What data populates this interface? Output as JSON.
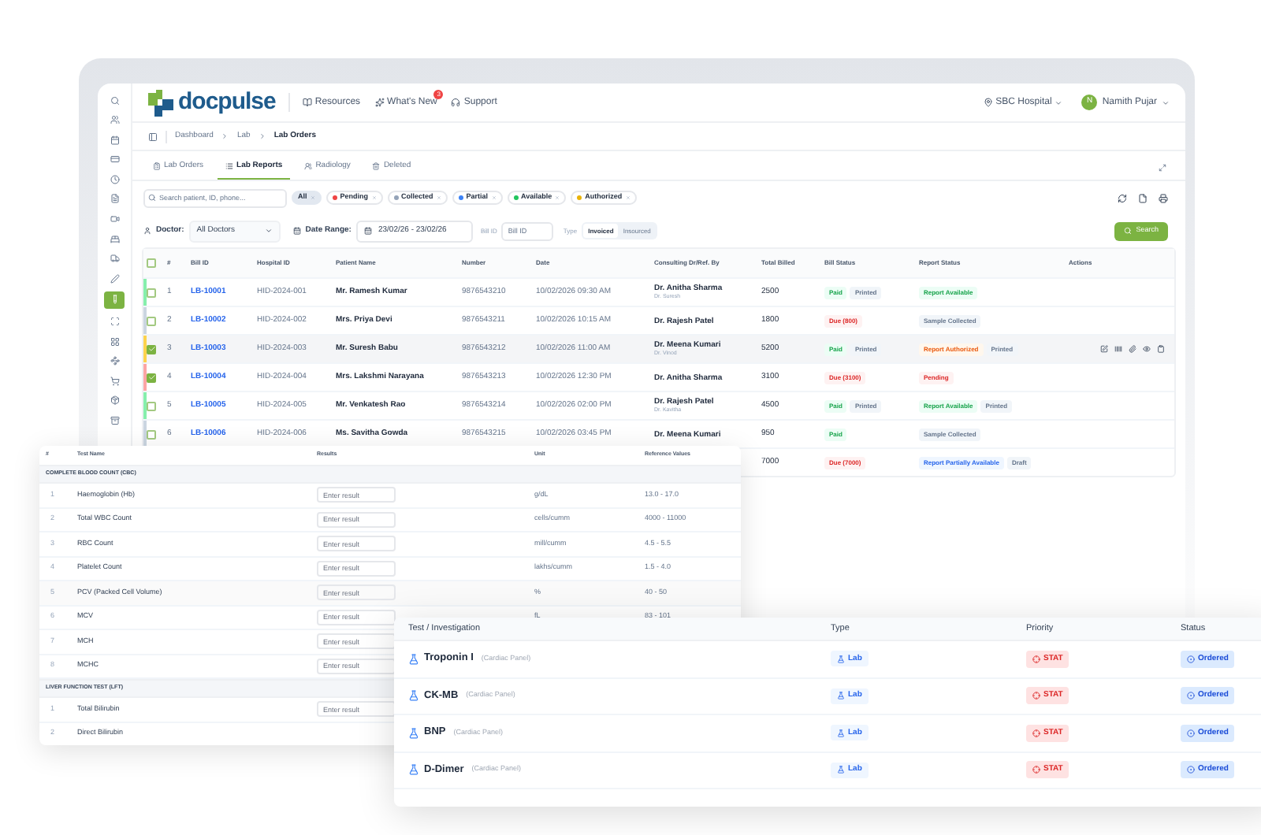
{
  "sidebar": {
    "items": [
      {
        "selected": false
      },
      {
        "selected": false
      },
      {
        "selected": false
      },
      {
        "selected": false
      },
      {
        "selected": false
      },
      {
        "selected": false
      },
      {
        "selected": false
      },
      {
        "selected": false
      },
      {
        "selected": false
      },
      {
        "selected": false
      },
      {
        "selected": true
      },
      {
        "selected": false
      },
      {
        "selected": false
      },
      {
        "selected": false
      },
      {
        "selected": false
      },
      {
        "selected": false
      },
      {
        "selected": false
      }
    ]
  },
  "header": {
    "logo": "docpulse",
    "nav": [
      {
        "label": "Resources"
      },
      {
        "label": "What's New",
        "badge": "3"
      },
      {
        "label": "Support"
      }
    ],
    "hospital": "SBC Hospital",
    "user": {
      "initial": "N",
      "name": "Namith Pujar"
    }
  },
  "breadcrumb": [
    "Dashboard",
    "Lab",
    "Lab Orders"
  ],
  "tabs": [
    {
      "label": "Lab Orders",
      "selected": false
    },
    {
      "label": "Lab Reports",
      "selected": true
    },
    {
      "label": "Radiology",
      "selected": false
    },
    {
      "label": "Deleted",
      "selected": false
    }
  ],
  "filters": {
    "search_placeholder": "Search patient, ID, phone...",
    "chips": [
      {
        "label": "All",
        "selected": true
      },
      {
        "label": "Pending",
        "color": "#ef4444",
        "selected": false
      },
      {
        "label": "Collected",
        "color": "#94a3b8",
        "selected": false
      },
      {
        "label": "Partial",
        "color": "#3b82f6",
        "selected": false
      },
      {
        "label": "Available",
        "color": "#22c55e",
        "selected": false
      },
      {
        "label": "Authorized",
        "color": "#eab308",
        "selected": false
      }
    ],
    "doctor": {
      "label": "Doctor:",
      "value": "All Doctors"
    },
    "date": {
      "label": "Date Range:",
      "value": "23/02/26 - 23/02/26"
    },
    "bill_id": {
      "label": "Bill ID",
      "placeholder": "Bill ID"
    },
    "type": {
      "label": "Type",
      "options": [
        {
          "label": "Invoiced",
          "selected": true
        },
        {
          "label": "Insourced",
          "selected": false
        }
      ]
    },
    "search_button": "Search"
  },
  "table": {
    "all_checked": false,
    "columns": [
      "#",
      "Bill ID",
      "Hospital ID",
      "Patient Name",
      "Number",
      "Date",
      "Consulting Dr/Ref. By",
      "Total Billed",
      "Bill Status",
      "Report Status",
      "Actions"
    ],
    "rows": [
      {
        "checked": false,
        "hovered": false,
        "color": "#86efac",
        "num": "1",
        "bill_id": "LB-10001",
        "hospital_id": "HID-2024-001",
        "patient": "Mr. Ramesh Kumar",
        "number": "9876543210",
        "date": "10/02/2026 09:30 AM",
        "doctor": "Dr. Anitha Sharma",
        "ref": "Dr. Suresh",
        "total": "2500",
        "bill_status": [
          {
            "label": "Paid",
            "kind": "green"
          },
          {
            "label": "Printed",
            "kind": "gray"
          }
        ],
        "report_status": [
          {
            "label": "Report Available",
            "kind": "green"
          }
        ]
      },
      {
        "checked": false,
        "hovered": false,
        "color": "#cbd5e1",
        "num": "2",
        "bill_id": "LB-10002",
        "hospital_id": "HID-2024-002",
        "patient": "Mrs. Priya Devi",
        "number": "9876543211",
        "date": "10/02/2026 10:15 AM",
        "doctor": "Dr. Rajesh Patel",
        "total": "1800",
        "bill_status": [
          {
            "label": "Due (800)",
            "kind": "red"
          }
        ],
        "report_status": [
          {
            "label": "Sample Collected",
            "kind": "gray"
          }
        ]
      },
      {
        "checked": true,
        "hovered": true,
        "color": "#fcd34d",
        "num": "3",
        "bill_id": "LB-10003",
        "hospital_id": "HID-2024-003",
        "patient": "Mr. Suresh Babu",
        "number": "9876543212",
        "date": "10/02/2026 11:00 AM",
        "doctor": "Dr. Meena Kumari",
        "ref": "Dr. Vinod",
        "total": "5200",
        "bill_status": [
          {
            "label": "Paid",
            "kind": "green"
          },
          {
            "label": "Printed",
            "kind": "gray"
          }
        ],
        "report_status": [
          {
            "label": "Report Authorized",
            "kind": "orange"
          },
          {
            "label": "Printed",
            "kind": "gray"
          }
        ]
      },
      {
        "checked": true,
        "hovered": false,
        "color": "#fca5a5",
        "num": "4",
        "bill_id": "LB-10004",
        "hospital_id": "HID-2024-004",
        "patient": "Mrs. Lakshmi Narayana",
        "number": "9876543213",
        "date": "10/02/2026 12:30 PM",
        "doctor": "Dr. Anitha Sharma",
        "total": "3100",
        "bill_status": [
          {
            "label": "Due (3100)",
            "kind": "red"
          }
        ],
        "report_status": [
          {
            "label": "Pending",
            "kind": "red"
          }
        ]
      },
      {
        "checked": false,
        "hovered": false,
        "color": "#86efac",
        "num": "5",
        "bill_id": "LB-10005",
        "hospital_id": "HID-2024-005",
        "patient": "Mr. Venkatesh Rao",
        "number": "9876543214",
        "date": "10/02/2026 02:00 PM",
        "doctor": "Dr. Rajesh Patel",
        "ref": "Dr. Kavitha",
        "total": "4500",
        "bill_status": [
          {
            "label": "Paid",
            "kind": "green"
          },
          {
            "label": "Printed",
            "kind": "gray"
          }
        ],
        "report_status": [
          {
            "label": "Report Available",
            "kind": "green"
          },
          {
            "label": "Printed",
            "kind": "gray"
          }
        ]
      },
      {
        "checked": false,
        "hovered": false,
        "color": "#cbd5e1",
        "num": "6",
        "bill_id": "LB-10006",
        "hospital_id": "HID-2024-006",
        "patient": "Ms. Savitha Gowda",
        "number": "9876543215",
        "date": "10/02/2026 03:45 PM",
        "doctor": "Dr. Meena Kumari",
        "total": "950",
        "bill_status": [
          {
            "label": "Paid",
            "kind": "green"
          }
        ],
        "report_status": [
          {
            "label": "Sample Collected",
            "kind": "gray"
          }
        ]
      },
      {
        "total": "7000",
        "bill_status": [
          {
            "label": "Due (7000)",
            "kind": "red"
          }
        ],
        "report_status": [
          {
            "label": "Report Partially Available",
            "kind": "blue"
          },
          {
            "label": "Draft",
            "kind": "gray"
          }
        ]
      }
    ]
  },
  "results_card": {
    "columns": [
      "#",
      "Test Name",
      "Results",
      "Unit",
      "Reference Values"
    ],
    "sections": [
      {
        "title": "COMPLETE BLOOD COUNT (CBC)",
        "rows": [
          {
            "num": "1",
            "name": "Haemoglobin (Hb)",
            "placeholder": "Enter result",
            "unit": "g/dL",
            "reference": "13.0 - 17.0"
          },
          {
            "num": "2",
            "name": "Total WBC Count",
            "placeholder": "Enter result",
            "unit": "cells/cumm",
            "reference": "4000 - 11000"
          },
          {
            "num": "3",
            "name": "RBC Count",
            "placeholder": "Enter result",
            "unit": "mill/cumm",
            "reference": "4.5 - 5.5"
          },
          {
            "num": "4",
            "name": "Platelet Count",
            "placeholder": "Enter result",
            "unit": "lakhs/cumm",
            "reference": "1.5 - 4.0"
          },
          {
            "num": "5",
            "name": "PCV (Packed Cell Volume)",
            "placeholder": "Enter result",
            "unit": "%",
            "reference": "40 - 50"
          },
          {
            "num": "6",
            "name": "MCV",
            "placeholder": "Enter result",
            "unit": "fL",
            "reference": "83 - 101"
          },
          {
            "num": "7",
            "name": "MCH",
            "placeholder": "Enter result"
          },
          {
            "num": "8",
            "name": "MCHC",
            "placeholder": "Enter result"
          }
        ]
      },
      {
        "title": "LIVER FUNCTION TEST (LFT)",
        "rows": [
          {
            "num": "1",
            "name": "Total Bilirubin",
            "placeholder": "Enter result"
          },
          {
            "num": "2",
            "name": "Direct Bilirubin"
          }
        ]
      }
    ]
  },
  "orders_card": {
    "columns": [
      "Test / Investigation",
      "Type",
      "Priority",
      "Status"
    ],
    "rows": [
      {
        "name": "Troponin I",
        "panel": "(Cardiac Panel)",
        "type": "Lab",
        "priority": "STAT",
        "status": "Ordered"
      },
      {
        "name": "CK-MB",
        "panel": "(Cardiac Panel)",
        "type": "Lab",
        "priority": "STAT",
        "status": "Ordered"
      },
      {
        "name": "BNP",
        "panel": "(Cardiac Panel)",
        "type": "Lab",
        "priority": "STAT",
        "status": "Ordered"
      },
      {
        "name": "D-Dimer",
        "panel": "(Cardiac Panel)",
        "type": "Lab",
        "priority": "STAT",
        "status": "Ordered"
      }
    ]
  }
}
